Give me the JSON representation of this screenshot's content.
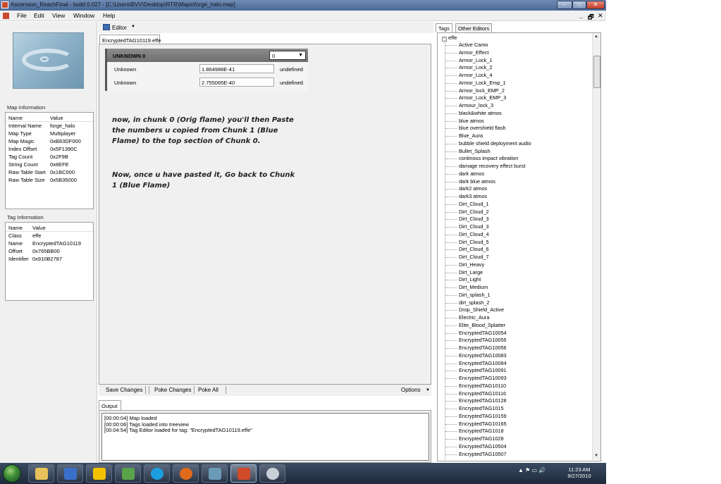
{
  "window": {
    "title": "Ascension_ReachFinal - build 0.027 - [C:\\Users\\BVV\\Desktop\\RTR\\Maps\\forge_halo.map]",
    "minimize": "–",
    "maximize": "□",
    "close": "✕",
    "mdi_minimize": "_",
    "mdi_restore": "🗗",
    "mdi_close": "✕"
  },
  "menu": {
    "items": [
      "File",
      "Edit",
      "View",
      "Window",
      "Help"
    ]
  },
  "map_info": {
    "title": "Map Information",
    "col_name": "Name",
    "col_value": "Value",
    "rows": [
      {
        "name": "Internal Name",
        "value": "forge_halo"
      },
      {
        "name": "Map Type",
        "value": "Multiplayer"
      },
      {
        "name": "Map Magic",
        "value": "0xB83DF000"
      },
      {
        "name": "Index Offset",
        "value": "0x5F1390C"
      },
      {
        "name": "Tag Count",
        "value": "0x2F9B"
      },
      {
        "name": "String Count",
        "value": "0x8EFE"
      },
      {
        "name": "Raw Table Start",
        "value": "0x1BC000"
      },
      {
        "name": "Raw Table Size",
        "value": "0x5B35000"
      }
    ]
  },
  "tag_info": {
    "title": "Tag Information",
    "col_name": "Name",
    "col_value": "Value",
    "rows": [
      {
        "name": "Class",
        "value": "effe"
      },
      {
        "name": "Name",
        "value": "EncryptedTAG10119"
      },
      {
        "name": "Offset",
        "value": "0x765BB00"
      },
      {
        "name": "Identifier",
        "value": "0x910B2787"
      }
    ]
  },
  "editor": {
    "toolbar_label": "Editor",
    "doc_tab": "EncryptedTAG10119.effe",
    "chunk": {
      "title": "UNKNOWN 0",
      "select_value": "0",
      "rows": [
        {
          "label": "Unknown",
          "value": "1.864988E-41",
          "type": "undefined"
        },
        {
          "label": "Unknown",
          "value": "2.755065E-40",
          "type": "undefined"
        }
      ]
    },
    "annotation_1": "now, in chunk 0 (Orig flame) you'll then Paste the numbers u copied from Chunk 1 (Blue Flame) to the top section of Chunk 0.",
    "annotation_2": "Now, once u have pasted it, Go back to Chunk 1 (Blue Flame)",
    "bottom": {
      "save": "Save Changes",
      "poke": "Poke Changes",
      "poke_all": "Poke All",
      "options": "Options"
    }
  },
  "output": {
    "tab": "Output",
    "lines": [
      "[00:00:04] Map loaded",
      "[00:00:06] Tags loaded into treeview",
      "[00:04:54] Tag Editor loaded for tag: \"EncryptedTAG10119.effe\""
    ]
  },
  "tags": {
    "tab_tags": "Tags",
    "tab_other": "Other Editors",
    "root": "effe",
    "items": [
      "Active Camo",
      "Armor_Effect",
      "Armor_Lock_1",
      "Armor_Lock_2",
      "Armor_Lock_4",
      "Armor_Lock_Emp_1",
      "Armor_lock_EMP_2",
      "Armor_Lock_EMP_3",
      "Armour_lock_3",
      "black&white atmos",
      "blue atmos",
      "blue overshield flash",
      "Blue_Aura",
      "bubble shield deployment audio",
      "Bullet_Splash",
      "continous impact vibration",
      "damage recovery effect burst",
      "dark atmos",
      "dark blue atmos",
      "dark2 atmos",
      "dark3 atmos",
      "Dirt_Cloud_1",
      "Dirt_Cloud_2",
      "Dirt_Cloud_3",
      "Dirt_Cloud_3",
      "Dirt_Cloud_4",
      "Dirt_Cloud_5",
      "Dirt_Cloud_6",
      "Dirt_Cloud_7",
      "Dirt_Heavy",
      "Dirt_Large",
      "Dirt_Light",
      "Dirt_Medium",
      "Dirt_splash_1",
      "dirt_splash_2",
      "Drop_Shield_Active",
      "Electric_Aura",
      "Elite_Blood_Splatter",
      "EncryptedTAG10054",
      "EncryptedTAG10055",
      "EncryptedTAG10056",
      "EncryptedTAG10083",
      "EncryptedTAG10084",
      "EncryptedTAG10091",
      "EncryptedTAG10093",
      "EncryptedTAG10110",
      "EncryptedTAG10116",
      "EncryptedTAG10128",
      "EncryptedTAG1015",
      "EncryptedTAG10159",
      "EncryptedTAG10165",
      "EncryptedTAG1018",
      "EncryptedTAG1028",
      "EncryptedTAG10504",
      "EncryptedTAG10507"
    ]
  },
  "taskbar": {
    "clock_time": "11:23 AM",
    "clock_date": "9/27/2010",
    "tray_icons": "▲  ⚑  ▭  🔊"
  },
  "colors": {
    "accent": "#4a6a98",
    "chunk_header": "#7a7a7a",
    "taskbar": "#1e2a3c"
  }
}
